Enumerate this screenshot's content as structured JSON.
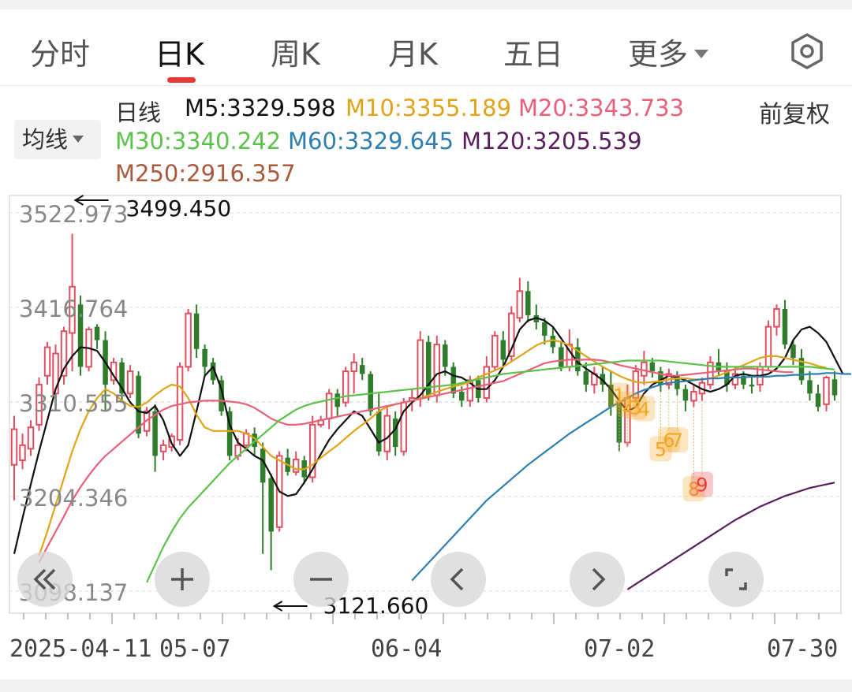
{
  "tabs": [
    {
      "label": "分时"
    },
    {
      "label": "日K"
    },
    {
      "label": "周K"
    },
    {
      "label": "月K"
    },
    {
      "label": "五日"
    },
    {
      "label": "更多"
    }
  ],
  "active_tab": "日K",
  "legend": {
    "label": "日线",
    "items": [
      {
        "text": "M5:3329.598",
        "color": "#111111"
      },
      {
        "text": "M10:3355.189",
        "color": "#e0a418"
      },
      {
        "text": "M20:3343.733",
        "color": "#e8607a"
      },
      {
        "text": "M30:3340.242",
        "color": "#5cc24a"
      },
      {
        "text": "M60:3329.645",
        "color": "#2e7fb0"
      },
      {
        "text": "M120:3205.539",
        "color": "#5a1e5e"
      },
      {
        "text": "M250:2916.357",
        "color": "#a85a3c"
      }
    ]
  },
  "ma_selector": "均线",
  "adjust_label": "前复权",
  "chart_data": {
    "type": "candlestick",
    "ylim": [
      3098.137,
      3522.973
    ],
    "y_ticks": [
      "3522.973",
      "3416.764",
      "3310.555",
      "3204.346",
      "3098.137"
    ],
    "x_ticks": [
      "2025-04-11",
      "05-07",
      "06-04",
      "07-02",
      "07-30"
    ],
    "high_label": "3499.450",
    "low_label": "3121.660",
    "candles": [
      [
        3240,
        3280,
        3200,
        3295
      ],
      [
        3245,
        3262,
        3235,
        3275
      ],
      [
        3258,
        3282,
        3250,
        3290
      ],
      [
        3285,
        3330,
        3278,
        3338
      ],
      [
        3340,
        3372,
        3330,
        3378
      ],
      [
        3320,
        3365,
        3315,
        3375
      ],
      [
        3340,
        3390,
        3330,
        3395
      ],
      [
        3388,
        3440,
        3345,
        3499.45
      ],
      [
        3420,
        3350,
        3340,
        3430
      ],
      [
        3350,
        3392,
        3345,
        3395
      ],
      [
        3395,
        3380,
        3370,
        3398
      ],
      [
        3380,
        3330,
        3300,
        3390
      ],
      [
        3335,
        3355,
        3330,
        3360
      ],
      [
        3355,
        3320,
        3310,
        3360
      ],
      [
        3320,
        3345,
        3315,
        3352
      ],
      [
        3340,
        3275,
        3270,
        3345
      ],
      [
        3278,
        3300,
        3272,
        3305
      ],
      [
        3300,
        3250,
        3232,
        3308
      ],
      [
        3255,
        3262,
        3245,
        3268
      ],
      [
        3260,
        3272,
        3255,
        3275
      ],
      [
        3268,
        3350,
        3262,
        3355
      ],
      [
        3350,
        3410,
        3345,
        3415
      ],
      [
        3410,
        3370,
        3360,
        3420
      ],
      [
        3370,
        3350,
        3340,
        3375
      ],
      [
        3355,
        3335,
        3330,
        3360
      ],
      [
        3335,
        3300,
        3295,
        3340
      ],
      [
        3300,
        3250,
        3245,
        3305
      ],
      [
        3250,
        3262,
        3245,
        3270
      ],
      [
        3262,
        3275,
        3255,
        3280
      ],
      [
        3275,
        3260,
        3250,
        3282
      ],
      [
        3258,
        3220,
        3140,
        3265
      ],
      [
        3225,
        3165,
        3121.66,
        3230
      ],
      [
        3170,
        3250,
        3165,
        3255
      ],
      [
        3248,
        3232,
        3228,
        3258
      ],
      [
        3232,
        3246,
        3228,
        3255
      ],
      [
        3245,
        3226,
        3220,
        3250
      ],
      [
        3226,
        3285,
        3220,
        3295
      ],
      [
        3285,
        3290,
        3282,
        3295
      ],
      [
        3292,
        3320,
        3280,
        3325
      ],
      [
        3320,
        3305,
        3295,
        3325
      ],
      [
        3310,
        3345,
        3305,
        3350
      ],
      [
        3345,
        3355,
        3320,
        3365
      ],
      [
        3352,
        3342,
        3335,
        3360
      ],
      [
        3342,
        3300,
        3295,
        3345
      ],
      [
        3300,
        3255,
        3250,
        3320
      ],
      [
        3255,
        3295,
        3245,
        3305
      ],
      [
        3292,
        3260,
        3250,
        3300
      ],
      [
        3255,
        3310,
        3250,
        3315
      ],
      [
        3312,
        3315,
        3300,
        3325
      ],
      [
        3315,
        3380,
        3305,
        3390
      ],
      [
        3378,
        3318,
        3312,
        3385
      ],
      [
        3318,
        3375,
        3310,
        3385
      ],
      [
        3375,
        3350,
        3340,
        3380
      ],
      [
        3350,
        3320,
        3315,
        3355
      ],
      [
        3322,
        3312,
        3305,
        3328
      ],
      [
        3312,
        3335,
        3305,
        3340
      ],
      [
        3335,
        3315,
        3310,
        3340
      ],
      [
        3315,
        3350,
        3310,
        3362
      ],
      [
        3350,
        3385,
        3345,
        3390
      ],
      [
        3380,
        3358,
        3350,
        3390
      ],
      [
        3362,
        3410,
        3355,
        3418
      ],
      [
        3405,
        3435,
        3400,
        3450
      ],
      [
        3435,
        3408,
        3400,
        3446
      ],
      [
        3408,
        3400,
        3392,
        3420
      ],
      [
        3400,
        3385,
        3375,
        3405
      ],
      [
        3385,
        3372,
        3365,
        3395
      ],
      [
        3372,
        3350,
        3345,
        3378
      ],
      [
        3350,
        3375,
        3345,
        3392
      ],
      [
        3372,
        3345,
        3340,
        3382
      ],
      [
        3345,
        3330,
        3322,
        3355
      ],
      [
        3330,
        3342,
        3320,
        3350
      ],
      [
        3342,
        3330,
        3322,
        3350
      ],
      [
        3330,
        3305,
        3295,
        3345
      ],
      [
        3310,
        3265,
        3255,
        3312
      ],
      [
        3265,
        3315,
        3260,
        3330
      ],
      [
        3315,
        3345,
        3310,
        3352
      ],
      [
        3340,
        3355,
        3330,
        3368
      ],
      [
        3355,
        3345,
        3338,
        3360
      ],
      [
        3345,
        3330,
        3322,
        3350
      ],
      [
        3330,
        3342,
        3325,
        3348
      ],
      [
        3340,
        3325,
        3318,
        3345
      ],
      [
        3325,
        3312,
        3300,
        3330
      ],
      [
        3312,
        3322,
        3305,
        3330
      ],
      [
        3320,
        3332,
        3312,
        3338
      ],
      [
        3330,
        3355,
        3325,
        3362
      ],
      [
        3355,
        3345,
        3340,
        3370
      ],
      [
        3345,
        3330,
        3322,
        3355
      ],
      [
        3330,
        3342,
        3325,
        3350
      ],
      [
        3340,
        3330,
        3325,
        3345
      ],
      [
        3330,
        3328,
        3320,
        3338
      ],
      [
        3330,
        3350,
        3322,
        3355
      ],
      [
        3350,
        3395,
        3345,
        3402
      ],
      [
        3395,
        3415,
        3385,
        3420
      ],
      [
        3415,
        3375,
        3370,
        3425
      ],
      [
        3375,
        3360,
        3352,
        3380
      ],
      [
        3360,
        3335,
        3330,
        3370
      ],
      [
        3335,
        3320,
        3312,
        3345
      ],
      [
        3320,
        3305,
        3300,
        3330
      ],
      [
        3308,
        3338,
        3300,
        3340
      ],
      [
        3336,
        3318,
        3312,
        3345
      ]
    ],
    "ma_series": [
      {
        "name": "M5",
        "color": "#111111",
        "start": 0,
        "values": [
          3140,
          3180,
          3218,
          3255,
          3290,
          3325,
          3348,
          3362,
          3372,
          3371,
          3368,
          3355,
          3340,
          3326,
          3310,
          3300,
          3298,
          3306,
          3290,
          3264,
          3250,
          3262,
          3300,
          3340,
          3350,
          3325,
          3285,
          3265,
          3258,
          3250,
          3245,
          3228,
          3210,
          3205,
          3207,
          3220,
          3235,
          3252,
          3268,
          3280,
          3290,
          3300,
          3295,
          3280,
          3265,
          3270,
          3280,
          3300,
          3310,
          3318,
          3330,
          3342,
          3345,
          3340,
          3338,
          3332,
          3325,
          3325,
          3335,
          3350,
          3370,
          3392,
          3402,
          3405,
          3402,
          3395,
          3382,
          3368,
          3355,
          3348,
          3342,
          3335,
          3325,
          3312,
          3300,
          3305,
          3320,
          3330,
          3335,
          3340,
          3338,
          3335,
          3330,
          3325,
          3322,
          3325,
          3330,
          3340,
          3342,
          3340,
          3340,
          3342,
          3348,
          3360,
          3380,
          3392,
          3395,
          3388,
          3378,
          3360,
          3342
        ]
      },
      {
        "name": "M10",
        "color": "#e0a418",
        "start": 3,
        "values": [
          3138,
          3165,
          3195,
          3225,
          3255,
          3280,
          3300,
          3315,
          3325,
          3320,
          3312,
          3306,
          3305,
          3310,
          3318,
          3325,
          3330,
          3328,
          3315,
          3296,
          3282,
          3278,
          3278,
          3278,
          3278,
          3275,
          3270,
          3260,
          3250,
          3245,
          3240,
          3235,
          3235,
          3240,
          3248,
          3255,
          3262,
          3270,
          3278,
          3285,
          3292,
          3300,
          3305,
          3308,
          3310,
          3312,
          3315,
          3318,
          3322,
          3325,
          3328,
          3330,
          3333,
          3338,
          3342,
          3346,
          3350,
          3356,
          3362,
          3368,
          3374,
          3378,
          3380,
          3378,
          3374,
          3368,
          3362,
          3356,
          3350,
          3345,
          3340,
          3336,
          3333,
          3332,
          3333,
          3334,
          3336,
          3337,
          3337,
          3336,
          3336,
          3337,
          3340,
          3344,
          3348,
          3352,
          3356,
          3360,
          3362,
          3362,
          3360,
          3358,
          3356,
          3354,
          3351,
          3349
        ]
      },
      {
        "name": "M20",
        "color": "#e8607a",
        "start": 3,
        "values": [
          3130,
          3148,
          3165,
          3182,
          3200,
          3215,
          3228,
          3240,
          3250,
          3258,
          3266,
          3274,
          3282,
          3290,
          3296,
          3302,
          3306,
          3308,
          3310,
          3311,
          3312,
          3312,
          3312,
          3311,
          3310,
          3308,
          3304,
          3298,
          3292,
          3288,
          3285,
          3285,
          3286,
          3288,
          3290,
          3292,
          3294,
          3296,
          3298,
          3300,
          3302,
          3304,
          3306,
          3308,
          3310,
          3312,
          3314,
          3316,
          3318,
          3320,
          3322,
          3324,
          3326,
          3328,
          3330,
          3332,
          3334,
          3338,
          3342,
          3346,
          3350,
          3354,
          3356,
          3357,
          3358,
          3358,
          3358,
          3358,
          3357,
          3355,
          3352,
          3350,
          3348,
          3346,
          3344,
          3342,
          3340,
          3340,
          3341,
          3342,
          3343,
          3344,
          3345,
          3346,
          3347,
          3348,
          3348,
          3347,
          3346,
          3345,
          3344,
          3344
        ]
      },
      {
        "name": "M30",
        "color": "#5cc24a",
        "start": 16,
        "values": [
          3108,
          3128,
          3148,
          3165,
          3180,
          3192,
          3202,
          3212,
          3222,
          3232,
          3242,
          3250,
          3258,
          3266,
          3274,
          3282,
          3290,
          3296,
          3302,
          3306,
          3309,
          3311,
          3313,
          3315,
          3317,
          3318,
          3319,
          3320,
          3321,
          3322,
          3323,
          3324,
          3325,
          3326,
          3327,
          3328,
          3329,
          3330,
          3332,
          3334,
          3336,
          3338,
          3340,
          3342,
          3343,
          3344,
          3345,
          3346,
          3347,
          3348,
          3349,
          3350,
          3351,
          3352,
          3353,
          3354,
          3355,
          3356,
          3357,
          3357,
          3357,
          3357,
          3357,
          3356,
          3355,
          3354,
          3353,
          3352,
          3351,
          3350,
          3350,
          3350,
          3350,
          3350,
          3350,
          3350,
          3350,
          3350,
          3350,
          3350,
          3350,
          3349,
          3348,
          3347
        ]
      },
      {
        "name": "M60",
        "color": "#2e7fb0",
        "start": 48,
        "values": [
          3110,
          3120,
          3130,
          3140,
          3150,
          3160,
          3170,
          3180,
          3190,
          3200,
          3208,
          3216,
          3224,
          3232,
          3240,
          3247,
          3254,
          3261,
          3268,
          3275,
          3281,
          3287,
          3293,
          3299,
          3305,
          3310,
          3315,
          3320,
          3324,
          3327,
          3330,
          3332,
          3333,
          3334,
          3335,
          3336,
          3337,
          3337,
          3338,
          3338,
          3338,
          3339,
          3339,
          3339,
          3340,
          3340,
          3341,
          3341,
          3342,
          3342,
          3343,
          3343,
          3342,
          3342
        ]
      },
      {
        "name": "M120",
        "color": "#5a1e5e",
        "start": 74,
        "values": [
          3100,
          3106,
          3112,
          3118,
          3124,
          3130,
          3136,
          3142,
          3148,
          3154,
          3160,
          3166,
          3172,
          3178,
          3183,
          3188,
          3193,
          3197,
          3201,
          3205,
          3208,
          3211,
          3214,
          3216,
          3218,
          3220
        ]
      }
    ],
    "signals": [
      {
        "label": "1",
        "idx": 73,
        "price": 3318,
        "color": "#f5a623"
      },
      {
        "label": "2",
        "idx": 74,
        "price": 3308,
        "color": "#f5a623"
      },
      {
        "label": "3",
        "idx": 75,
        "price": 3305,
        "color": "#f5a623"
      },
      {
        "label": "4",
        "idx": 76,
        "price": 3303,
        "color": "#f5a623"
      },
      {
        "label": "5",
        "idx": 78,
        "price": 3258,
        "color": "#f5a623"
      },
      {
        "label": "6",
        "idx": 79,
        "price": 3268,
        "color": "#f5a623"
      },
      {
        "label": "7",
        "idx": 80,
        "price": 3268,
        "color": "#f5a623"
      },
      {
        "label": "8",
        "idx": 82,
        "price": 3213,
        "color": "#f5a623"
      },
      {
        "label": "9",
        "idx": 83,
        "price": 3218,
        "color": "#e53e3e"
      }
    ],
    "colors": {
      "up": "#e04f5f",
      "down": "#2f7d2a",
      "grid": "#dddddd",
      "axis": "#999999",
      "tick_text": "#888888"
    }
  },
  "controls": [
    {
      "name": "prev-fast",
      "icon": "double-chevron-left-icon"
    },
    {
      "name": "zoom-in",
      "icon": "plus-icon"
    },
    {
      "name": "zoom-out",
      "icon": "minus-icon"
    },
    {
      "name": "prev",
      "icon": "chevron-left-icon"
    },
    {
      "name": "next",
      "icon": "chevron-right-icon"
    },
    {
      "name": "fullscreen",
      "icon": "fullscreen-icon"
    }
  ]
}
